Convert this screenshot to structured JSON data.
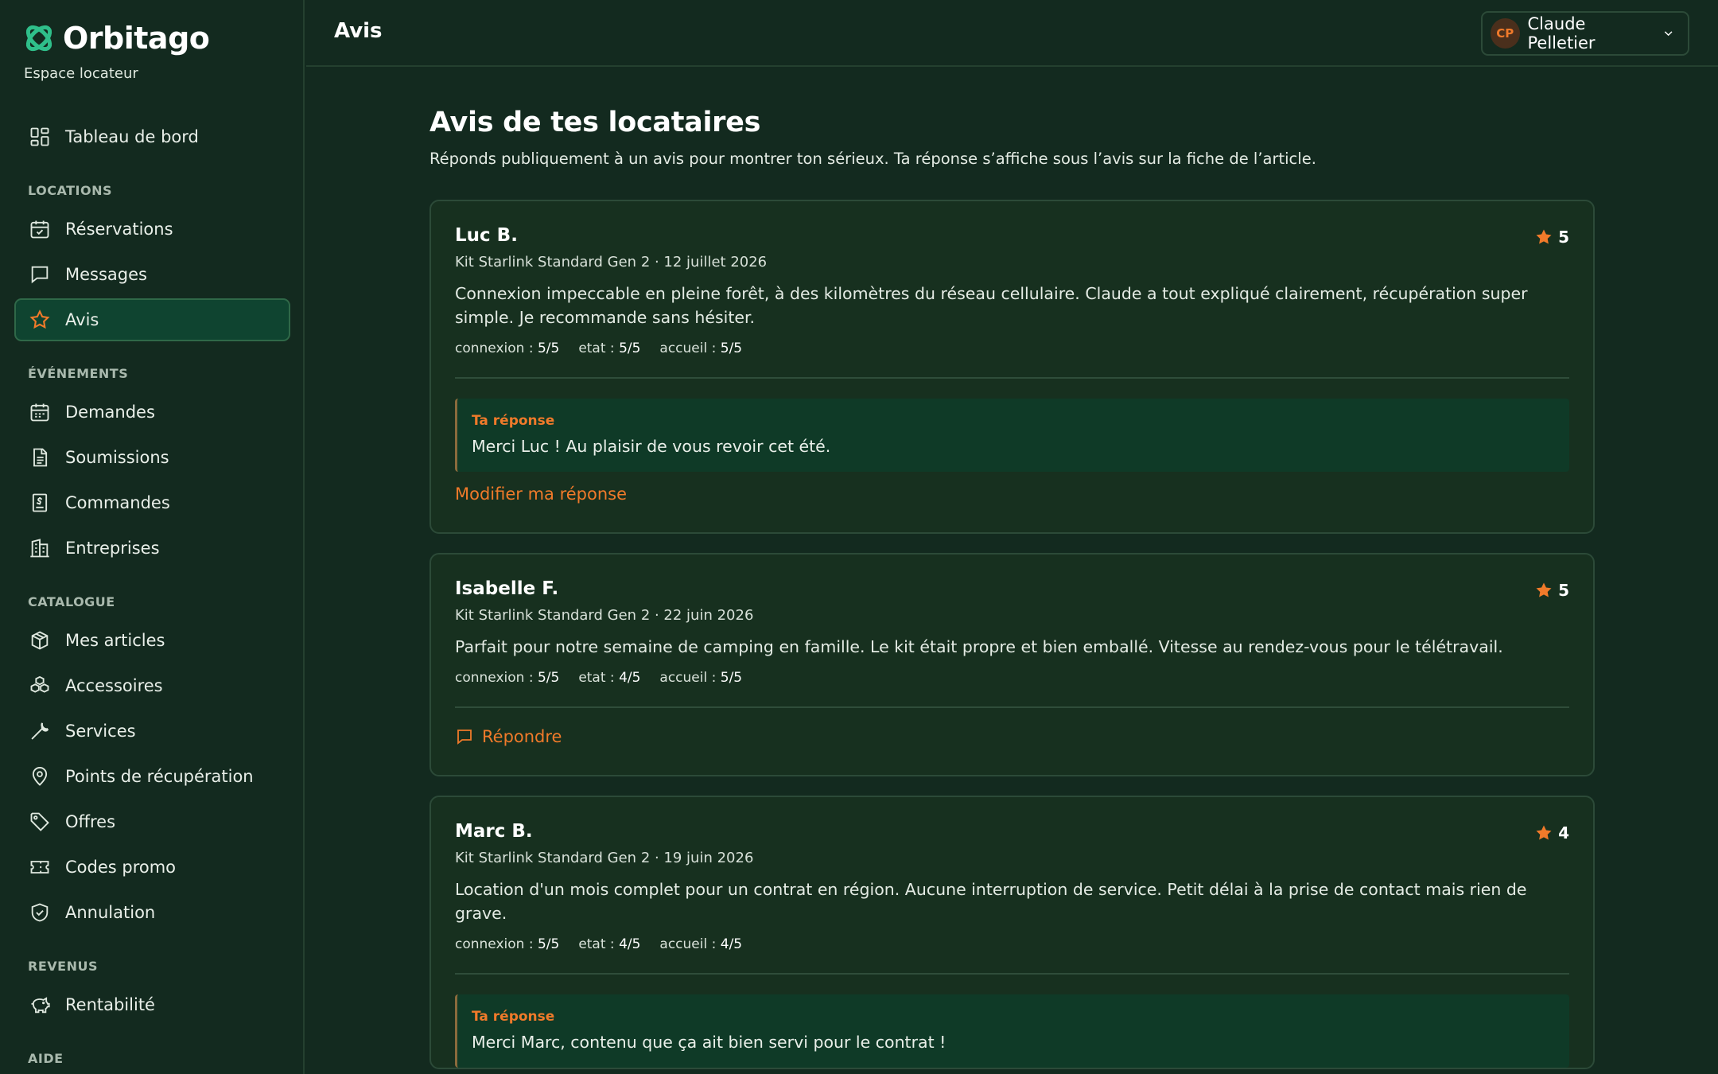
{
  "brand": {
    "name": "Orbitago",
    "subtitle": "Espace locateur"
  },
  "sidebar": {
    "top": [
      {
        "label": "Tableau de bord",
        "icon": "dashboard-icon"
      }
    ],
    "sections": [
      {
        "title": "LOCATIONS",
        "items": [
          {
            "label": "Réservations",
            "icon": "calendar-check-icon"
          },
          {
            "label": "Messages",
            "icon": "message-icon"
          },
          {
            "label": "Avis",
            "icon": "star-icon",
            "active": true
          }
        ]
      },
      {
        "title": "ÉVÉNEMENTS",
        "items": [
          {
            "label": "Demandes",
            "icon": "calendar-icon"
          },
          {
            "label": "Soumissions",
            "icon": "document-icon"
          },
          {
            "label": "Commandes",
            "icon": "receipt-icon"
          },
          {
            "label": "Entreprises",
            "icon": "building-icon"
          }
        ]
      },
      {
        "title": "CATALOGUE",
        "items": [
          {
            "label": "Mes articles",
            "icon": "box-icon"
          },
          {
            "label": "Accessoires",
            "icon": "boxes-icon"
          },
          {
            "label": "Services",
            "icon": "wrench-icon"
          },
          {
            "label": "Points de récupération",
            "icon": "map-pin-icon"
          },
          {
            "label": "Offres",
            "icon": "tag-icon"
          },
          {
            "label": "Codes promo",
            "icon": "ticket-icon"
          },
          {
            "label": "Annulation",
            "icon": "shield-check-icon"
          }
        ]
      },
      {
        "title": "REVENUS",
        "items": [
          {
            "label": "Rentabilité",
            "icon": "piggy-bank-icon"
          }
        ]
      },
      {
        "title": "AIDE",
        "items": []
      }
    ]
  },
  "header": {
    "title": "Avis",
    "user": {
      "initials": "CP",
      "name": "Claude Pelletier"
    }
  },
  "main": {
    "title": "Avis de tes locataires",
    "subtitle": "Réponds publiquement à un avis pour montrer ton sérieux. Ta réponse s’affiche sous l’avis sur la fiche de l’article.",
    "reviews": [
      {
        "name": "Luc B.",
        "rating": "5",
        "meta": "Kit Starlink Standard Gen 2 · 12 juillet 2026",
        "text": "Connexion impeccable en pleine forêt, à des kilomètres du réseau cellulaire. Claude a tout expliqué clairement, récupération super simple. Je recommande sans hésiter.",
        "scores": [
          {
            "label": "connexion :",
            "value": "5/5"
          },
          {
            "label": "etat :",
            "value": "5/5"
          },
          {
            "label": "accueil :",
            "value": "5/5"
          }
        ],
        "reply_label": "Ta réponse",
        "reply_text": "Merci Luc ! Au plaisir de vous revoir cet été.",
        "action": "Modifier ma réponse"
      },
      {
        "name": "Isabelle F.",
        "rating": "5",
        "meta": "Kit Starlink Standard Gen 2 · 22 juin 2026",
        "text": "Parfait pour notre semaine de camping en famille. Le kit était propre et bien emballé. Vitesse au rendez-vous pour le télétravail.",
        "scores": [
          {
            "label": "connexion :",
            "value": "5/5"
          },
          {
            "label": "etat :",
            "value": "4/5"
          },
          {
            "label": "accueil :",
            "value": "5/5"
          }
        ],
        "action": "Répondre"
      },
      {
        "name": "Marc B.",
        "rating": "4",
        "meta": "Kit Starlink Standard Gen 2 · 19 juin 2026",
        "text": "Location d'un mois complet pour un contrat en région. Aucune interruption de service. Petit délai à la prise de contact mais rien de grave.",
        "scores": [
          {
            "label": "connexion :",
            "value": "5/5"
          },
          {
            "label": "etat :",
            "value": "4/5"
          },
          {
            "label": "accueil :",
            "value": "4/5"
          }
        ],
        "reply_label": "Ta réponse",
        "reply_text": "Merci Marc, contenu que ça ait bien servi pour le contrat !"
      }
    ]
  },
  "colors": {
    "accent": "#f07a2a",
    "bg": "#132a1f",
    "card": "#17301f",
    "active": "#0f4430"
  }
}
